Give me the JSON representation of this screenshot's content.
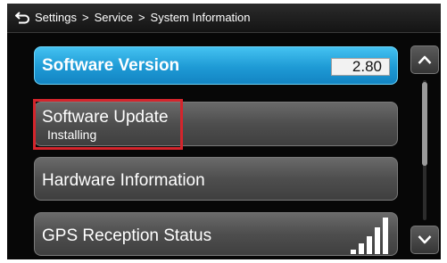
{
  "header": {
    "back_icon": "back-arrow-icon",
    "breadcrumb": [
      "Settings",
      "Service",
      "System Information"
    ],
    "separator": ">"
  },
  "menu": {
    "software_version": {
      "label": "Software Version",
      "value": "2.80"
    },
    "software_update": {
      "label": "Software Update",
      "status": "Installing"
    },
    "hardware_information": {
      "label": "Hardware Information"
    },
    "gps_reception_status": {
      "label": "GPS Reception Status",
      "icon": "signal-strength-icon"
    }
  },
  "scroll": {
    "up_icon": "chevron-up-icon",
    "down_icon": "chevron-down-icon"
  },
  "colors": {
    "selected_row": "#1e9ad5",
    "row": "#4e4e4e",
    "highlight": "#d4252c",
    "background": "#070707"
  }
}
